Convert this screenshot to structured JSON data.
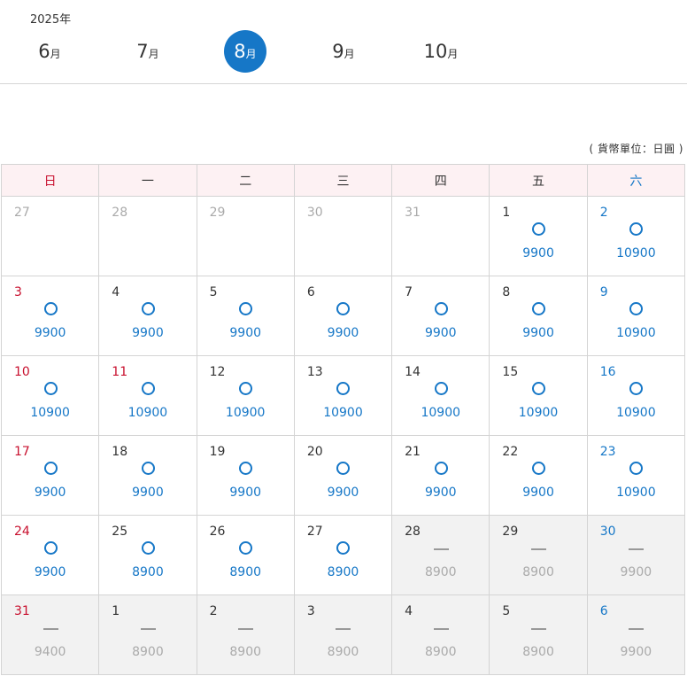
{
  "year_label": "2025年",
  "month_unit": "月",
  "months": [
    {
      "num": "6",
      "active": false
    },
    {
      "num": "7",
      "active": false
    },
    {
      "num": "8",
      "active": true
    },
    {
      "num": "9",
      "active": false
    },
    {
      "num": "10",
      "active": false
    }
  ],
  "currency_note": "( 貨幣單位：日圓 )",
  "weekdays": [
    "日",
    "一",
    "二",
    "三",
    "四",
    "五",
    "六"
  ],
  "colors": {
    "accent": "#1677c7",
    "sunday": "#c8102e",
    "header_bg": "#fdf1f3",
    "disabled_bg": "#f2f2f2"
  },
  "weeks": [
    [
      {
        "day": "27",
        "other": true
      },
      {
        "day": "28",
        "other": true
      },
      {
        "day": "29",
        "other": true
      },
      {
        "day": "30",
        "other": true
      },
      {
        "day": "31",
        "other": true
      },
      {
        "day": "1",
        "status": "available",
        "price": "9900"
      },
      {
        "day": "2",
        "status": "available",
        "price": "10900"
      }
    ],
    [
      {
        "day": "3",
        "status": "available",
        "price": "9900"
      },
      {
        "day": "4",
        "status": "available",
        "price": "9900"
      },
      {
        "day": "5",
        "status": "available",
        "price": "9900"
      },
      {
        "day": "6",
        "status": "available",
        "price": "9900"
      },
      {
        "day": "7",
        "status": "available",
        "price": "9900"
      },
      {
        "day": "8",
        "status": "available",
        "price": "9900"
      },
      {
        "day": "9",
        "status": "available",
        "price": "10900"
      }
    ],
    [
      {
        "day": "10",
        "status": "available",
        "price": "10900",
        "holiday": true
      },
      {
        "day": "11",
        "status": "available",
        "price": "10900",
        "holiday": true
      },
      {
        "day": "12",
        "status": "available",
        "price": "10900"
      },
      {
        "day": "13",
        "status": "available",
        "price": "10900"
      },
      {
        "day": "14",
        "status": "available",
        "price": "10900"
      },
      {
        "day": "15",
        "status": "available",
        "price": "10900"
      },
      {
        "day": "16",
        "status": "available",
        "price": "10900"
      }
    ],
    [
      {
        "day": "17",
        "status": "available",
        "price": "9900"
      },
      {
        "day": "18",
        "status": "available",
        "price": "9900"
      },
      {
        "day": "19",
        "status": "available",
        "price": "9900"
      },
      {
        "day": "20",
        "status": "available",
        "price": "9900"
      },
      {
        "day": "21",
        "status": "available",
        "price": "9900"
      },
      {
        "day": "22",
        "status": "available",
        "price": "9900"
      },
      {
        "day": "23",
        "status": "available",
        "price": "10900"
      }
    ],
    [
      {
        "day": "24",
        "status": "available",
        "price": "9900"
      },
      {
        "day": "25",
        "status": "available",
        "price": "8900"
      },
      {
        "day": "26",
        "status": "available",
        "price": "8900"
      },
      {
        "day": "27",
        "status": "available",
        "price": "8900"
      },
      {
        "day": "28",
        "status": "closed",
        "price": "8900"
      },
      {
        "day": "29",
        "status": "closed",
        "price": "8900"
      },
      {
        "day": "30",
        "status": "closed",
        "price": "9900"
      }
    ],
    [
      {
        "day": "31",
        "status": "closed",
        "price": "9400"
      },
      {
        "day": "1",
        "status": "closed",
        "price": "8900"
      },
      {
        "day": "2",
        "status": "closed",
        "price": "8900"
      },
      {
        "day": "3",
        "status": "closed",
        "price": "8900"
      },
      {
        "day": "4",
        "status": "closed",
        "price": "8900"
      },
      {
        "day": "5",
        "status": "closed",
        "price": "8900"
      },
      {
        "day": "6",
        "status": "closed",
        "price": "9900"
      }
    ]
  ]
}
